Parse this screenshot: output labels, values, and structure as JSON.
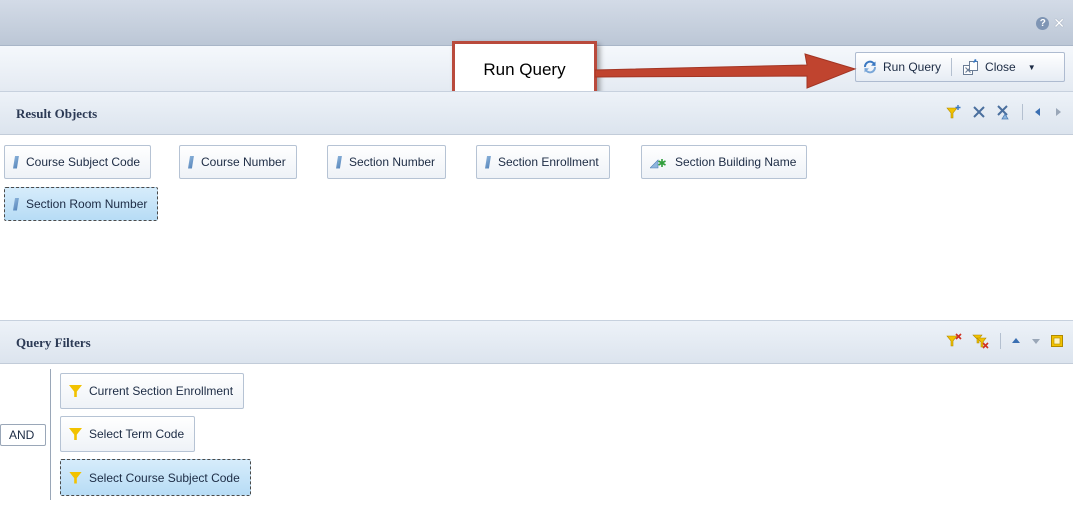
{
  "titlebar": {
    "help_glyph": "?",
    "close_glyph": "✕"
  },
  "toolbar": {
    "run_query_label": "Run Query",
    "close_label": "Close",
    "close_caret": "▼"
  },
  "callout": {
    "text": "Run Query"
  },
  "result_objects": {
    "title": "Result Objects",
    "items": [
      {
        "label": "Course Subject Code",
        "icon": "dimension-icon"
      },
      {
        "label": "Course Number",
        "icon": "dimension-icon"
      },
      {
        "label": "Section Number",
        "icon": "dimension-icon"
      },
      {
        "label": "Section Enrollment",
        "icon": "dimension-icon"
      },
      {
        "label": "Section Building Name",
        "icon": "detail-icon"
      },
      {
        "label": "Section Room Number",
        "icon": "dimension-icon",
        "selected": true
      }
    ]
  },
  "query_filters": {
    "title": "Query Filters",
    "operator": "AND",
    "items": [
      {
        "label": "Current Section Enrollment",
        "icon": "filter-icon"
      },
      {
        "label": "Select Term Code",
        "icon": "filter-icon"
      },
      {
        "label": "Select Course Subject Code",
        "icon": "filter-icon",
        "selected": true
      }
    ]
  },
  "colors": {
    "callout_border": "#b94a3c",
    "arrow": "#c0442f",
    "selection": "#b7dcf5",
    "header_bg": "#dce4ee"
  }
}
